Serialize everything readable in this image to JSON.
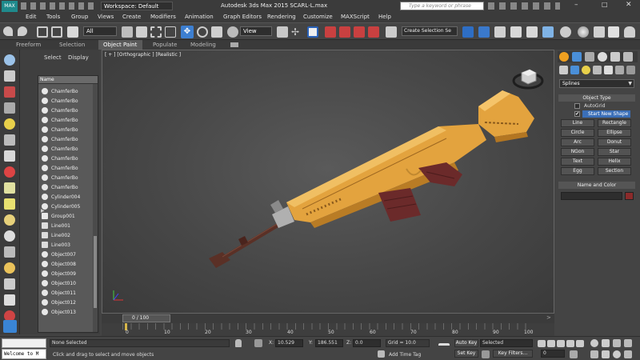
{
  "titlebar": {
    "workspace": "Workspace: Default",
    "title": "Autodesk 3ds Max  2015     SCARL-L.max",
    "search_placeholder": "Type a keyword or phrase"
  },
  "menu": [
    "Edit",
    "Tools",
    "Group",
    "Views",
    "Create",
    "Modifiers",
    "Animation",
    "Graph Editors",
    "Rendering",
    "Customize",
    "MAXScript",
    "Help"
  ],
  "maintoolbar": {
    "filter_value": "All",
    "refcoord_value": "View",
    "selection_set_value": "Create Selection Se"
  },
  "ribbon_tabs": [
    "Freeform",
    "Selection",
    "Object Paint",
    "Populate",
    "Modeling"
  ],
  "scene_explorer": {
    "tabs": [
      "Select",
      "Display"
    ],
    "column_name": "Name",
    "items": [
      "ChamferBo",
      "ChamferBo",
      "ChamferBo",
      "ChamferBo",
      "ChamferBo",
      "ChamferBo",
      "ChamferBo",
      "ChamferBo",
      "ChamferBo",
      "ChamferBo",
      "ChamferBo",
      "Cylinder004",
      "Cylinder005",
      "Group001",
      "Line001",
      "Line002",
      "Line003",
      "Object007",
      "Object008",
      "Object009",
      "Object010",
      "Object011",
      "Object012",
      "Object013"
    ]
  },
  "viewport": {
    "label": "[ + ] [Orthographic ] [Realistic ]",
    "model_colors": {
      "body": "#e3a33e",
      "grip": "#6b2a2a",
      "barrel": "#5a3026"
    }
  },
  "command_panel": {
    "category_value": "Splines",
    "object_type_title": "Object Type",
    "autogrid_label": "AutoGrid",
    "start_new_shape_label": "Start New Shape",
    "buttons": [
      "Line",
      "Rectangle",
      "Circle",
      "Ellipse",
      "Arc",
      "Donut",
      "NGon",
      "Star",
      "Text",
      "Helix",
      "Egg",
      "Section"
    ],
    "name_color_title": "Name and Color",
    "swatch_color": "#8b2b2b"
  },
  "timeline": {
    "frame_display": "0 / 100",
    "ticks": [
      "0",
      "10",
      "20",
      "30",
      "40",
      "50",
      "60",
      "70",
      "80",
      "90",
      "100"
    ]
  },
  "status": {
    "maxscript_listener": "Welcome to M",
    "selection_text": "None Selected",
    "prompt_text": "Click and drag to select and move objects",
    "x_label": "X:",
    "x_value": "10.529",
    "y_label": "Y:",
    "y_value": "186.551",
    "z_label": "Z:",
    "z_value": "0.0",
    "grid_text": "Grid = 10.0",
    "add_time_tag": "Add Time Tag",
    "auto_key": "Auto Key",
    "auto_key_value": "Selected",
    "set_key": "Set Key",
    "key_filters": "Key Filters...",
    "frame_value": "0"
  }
}
